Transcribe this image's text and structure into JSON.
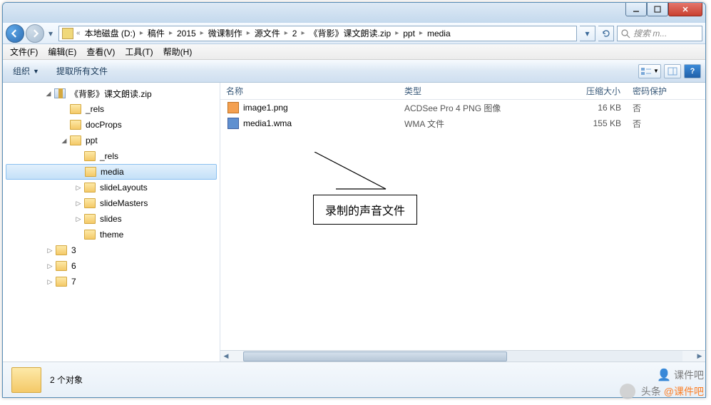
{
  "breadcrumb": {
    "segments": [
      "本地磁盘 (D:)",
      "稿件",
      "2015",
      "微课制作",
      "源文件",
      "2",
      "《背影》课文朗读.zip",
      "ppt",
      "media"
    ]
  },
  "search": {
    "placeholder": "搜索 m..."
  },
  "menus": {
    "file": "文件(F)",
    "edit": "编辑(E)",
    "view": "查看(V)",
    "tools": "工具(T)",
    "help": "帮助(H)"
  },
  "toolbar": {
    "organize": "组织",
    "extract": "提取所有文件"
  },
  "tree": {
    "root": "《背影》课文朗读.zip",
    "items": [
      {
        "indent": 2,
        "label": "_rels"
      },
      {
        "indent": 2,
        "label": "docProps"
      },
      {
        "indent": 2,
        "label": "ppt",
        "expanded": true
      },
      {
        "indent": 3,
        "label": "_rels"
      },
      {
        "indent": 3,
        "label": "media",
        "selected": true
      },
      {
        "indent": 3,
        "label": "slideLayouts",
        "expander": true
      },
      {
        "indent": 3,
        "label": "slideMasters",
        "expander": true
      },
      {
        "indent": 3,
        "label": "slides",
        "expander": true
      },
      {
        "indent": 3,
        "label": "theme"
      },
      {
        "indent": 1,
        "label": "3",
        "expander": true
      },
      {
        "indent": 1,
        "label": "6",
        "expander": true
      },
      {
        "indent": 1,
        "label": "7",
        "expander": true
      }
    ]
  },
  "columns": {
    "name": "名称",
    "type": "类型",
    "size": "压缩大小",
    "protection": "密码保护"
  },
  "files": [
    {
      "icon": "png",
      "name": "image1.png",
      "type": "ACDSee Pro 4 PNG 图像",
      "size": "16 KB",
      "protection": "否"
    },
    {
      "icon": "wma",
      "name": "media1.wma",
      "type": "WMA 文件",
      "size": "155 KB",
      "protection": "否"
    }
  ],
  "callout": "录制的声音文件",
  "status": {
    "count": "2 个对象"
  },
  "watermark": {
    "top": "课件吧",
    "left": "头条",
    "handle": "@课件吧"
  }
}
